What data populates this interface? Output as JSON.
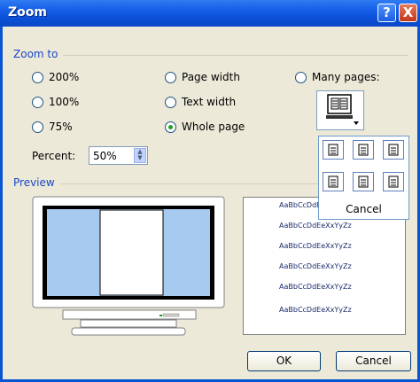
{
  "window": {
    "title": "Zoom",
    "help_glyph": "?",
    "close_glyph": "X"
  },
  "zoom_to": {
    "label": "Zoom to",
    "options": [
      {
        "label": "200%",
        "selected": false
      },
      {
        "label": "100%",
        "selected": false
      },
      {
        "label": "75%",
        "selected": false
      },
      {
        "label": "Page width",
        "selected": false
      },
      {
        "label": "Text width",
        "selected": false
      },
      {
        "label": "Whole page",
        "selected": true
      },
      {
        "label": "Many pages:",
        "selected": false
      }
    ]
  },
  "percent": {
    "label": "Percent:",
    "value": "50%"
  },
  "preview": {
    "label": "Preview",
    "samples": [
      "AaBbCcDdEeXxYyZz",
      "AaBbCcDdEeXxYyZz",
      "AaBbCcDdEeXxYyZz",
      "AaBbCcDdEeXxYyZz",
      "AaBbCcDdEeXxYyZz",
      "AaBbCcDdEeXxYyZz"
    ]
  },
  "many_pages_popup": {
    "cancel_label": "Cancel"
  },
  "buttons": {
    "ok": "OK",
    "cancel": "Cancel"
  },
  "colors": {
    "title_blue": "#0a54d4",
    "group_label": "#1a47c7",
    "dialog_bg": "#ece9d8",
    "radio_selected": "#21a121"
  }
}
